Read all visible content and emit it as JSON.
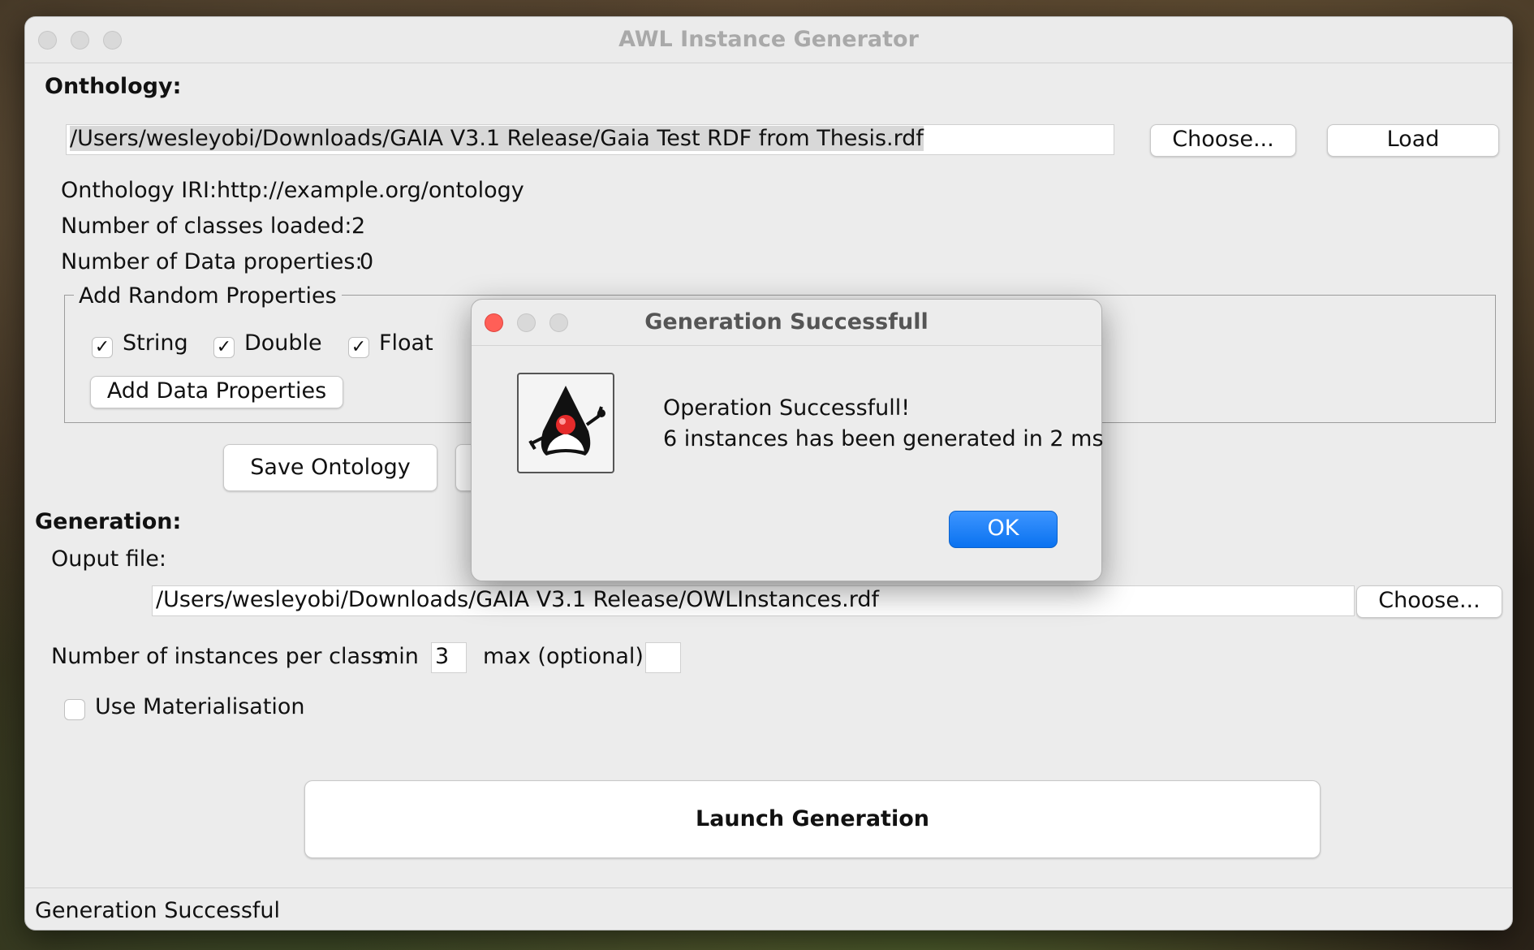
{
  "window": {
    "title": "AWL Instance Generator"
  },
  "ontology": {
    "section_label": "Onthology:",
    "path_value": "/Users/wesleyobi/Downloads/GAIA V3.1 Release/Gaia Test RDF from Thesis.rdf",
    "choose_label": "Choose...",
    "load_label": "Load",
    "iri_label": "Onthology IRI:",
    "iri_value": "http://example.org/ontology",
    "classes_label": "Number of classes loaded:",
    "classes_value": "2",
    "data_props_label": "Number of Data properties:",
    "data_props_value": "0"
  },
  "random_properties": {
    "group_title": "Add Random Properties",
    "checkboxes": [
      {
        "label": "String",
        "checked": true
      },
      {
        "label": "Double",
        "checked": true
      },
      {
        "label": "Float",
        "checked": true
      }
    ],
    "add_button_label": "Add Data Properties"
  },
  "save_ontology_label": "Save Ontology",
  "generation": {
    "section_label": "Generation:",
    "output_label": "Ouput file:",
    "output_value": "/Users/wesleyobi/Downloads/GAIA V3.1 Release/OWLInstances.rdf",
    "choose_label": "Choose...",
    "instances_label": "Number of instances per class:",
    "min_label": "min",
    "min_value": "3",
    "max_label": "max (optional)",
    "max_value": "",
    "materialisation_label": "Use Materialisation",
    "materialisation_checked": false,
    "launch_label": "Launch Generation"
  },
  "status": {
    "text": "Generation Successful"
  },
  "dialog": {
    "title": "Generation Successfull",
    "message_line1": "Operation Successfull!",
    "message_line2": "6 instances has been generated in 2 ms",
    "ok_label": "OK",
    "icon": "java-duke-icon"
  },
  "colors": {
    "close_red": "#ff5f57",
    "ok_blue": "#0a72f0",
    "window_bg": "#ececec"
  }
}
